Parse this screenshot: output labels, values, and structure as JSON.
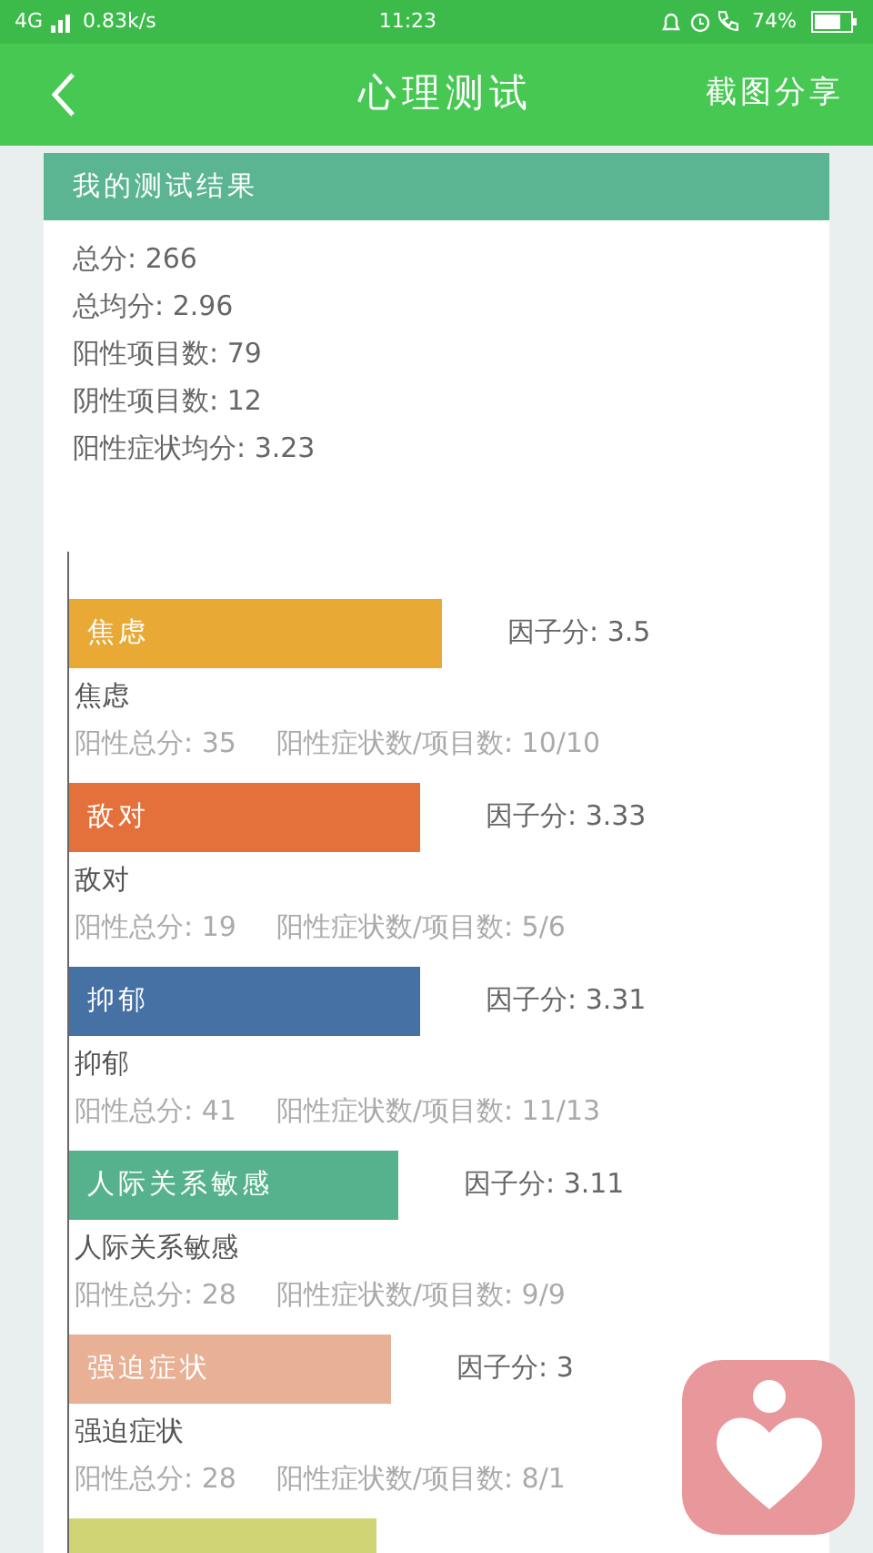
{
  "status_bar": {
    "network": "4G",
    "speed": "0.83k/s",
    "time": "11:23",
    "battery": "74%"
  },
  "header": {
    "title": "心理测试",
    "action": "截图分享"
  },
  "result": {
    "title": "我的测试结果",
    "stats": [
      "总分: 266",
      "总均分: 2.96",
      "阳性项目数: 79",
      "阴性项目数: 12",
      "阳性症状均分: 3.23"
    ]
  },
  "factors": [
    {
      "bar_label": "焦虑",
      "score": "因子分: 3.5",
      "name": "焦虑",
      "total": "阳性总分: 35",
      "ratio": "阳性症状数/项目数: 10/10",
      "color": "#e8a935"
    },
    {
      "bar_label": "敌对",
      "score": "因子分: 3.33",
      "name": "敌对",
      "total": "阳性总分: 19",
      "ratio": "阳性症状数/项目数: 5/6",
      "color": "#e4713b"
    },
    {
      "bar_label": "抑郁",
      "score": "因子分: 3.31",
      "name": "抑郁",
      "total": "阳性总分: 41",
      "ratio": "阳性症状数/项目数: 11/13",
      "color": "#4671a5"
    },
    {
      "bar_label": "人际关系敏感",
      "score": "因子分: 3.11",
      "name": "人际关系敏感",
      "total": "阳性总分: 28",
      "ratio": "阳性症状数/项目数: 9/9",
      "color": "#55b28d"
    },
    {
      "bar_label": "强迫症状",
      "score": "因子分: 3",
      "name": "强迫症状",
      "total": "阳性总分: 28",
      "ratio": "阳性症状数/项目数: 8/1",
      "color": "#e8b095"
    },
    {
      "color": "#d1d475"
    }
  ]
}
